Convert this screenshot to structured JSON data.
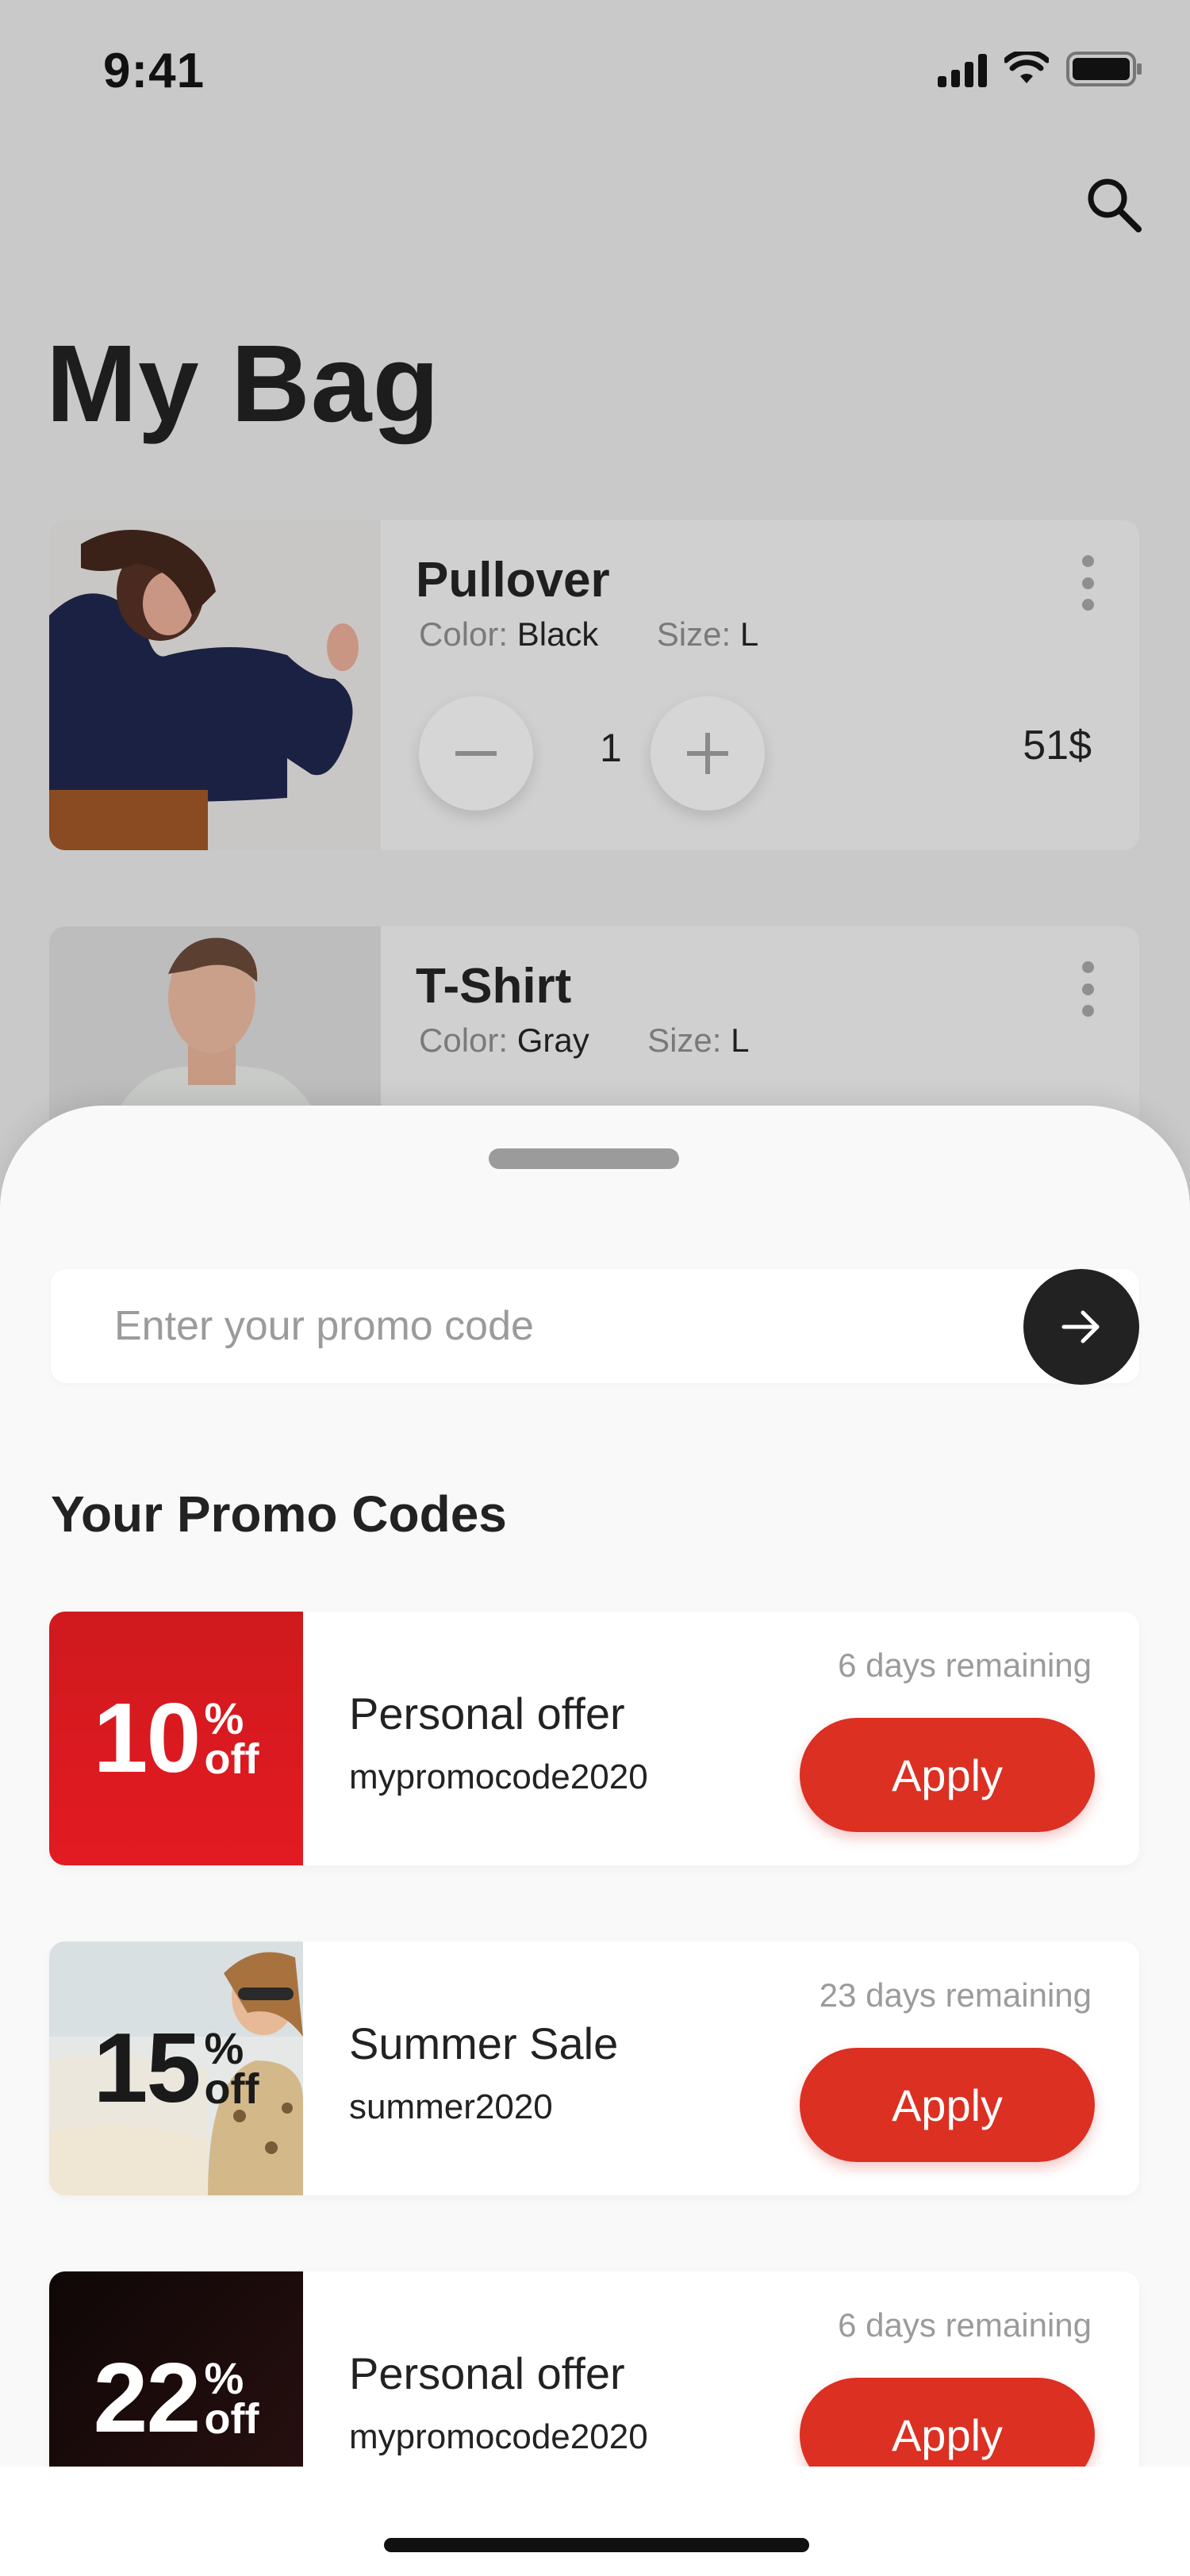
{
  "status_bar": {
    "time": "9:41",
    "icons": [
      "cellular-signal-icon",
      "wifi-icon",
      "battery-icon"
    ]
  },
  "header": {
    "title": "My Bag",
    "search_icon": "search-icon"
  },
  "bag_items": [
    {
      "name": "Pullover",
      "color_label": "Color:",
      "color": "Black",
      "size_label": "Size:",
      "size": "L",
      "quantity": "1",
      "price": "51$",
      "image": "woman-in-navy-pullover"
    },
    {
      "name": "T-Shirt",
      "color_label": "Color:",
      "color": "Gray",
      "size_label": "Size:",
      "size": "L",
      "image": "man-in-gray-tshirt"
    }
  ],
  "promo": {
    "placeholder": "Enter your promo code",
    "submit_icon": "arrow-right-icon",
    "section_title": "Your Promo Codes",
    "codes": [
      {
        "value": "10",
        "percent": "%",
        "off": "off",
        "title": "Personal offer",
        "code": "mypromocode2020",
        "remaining": "6 days remaining",
        "apply": "Apply",
        "badge_color": "#db1a1f"
      },
      {
        "value": "15",
        "percent": "%",
        "off": "off",
        "title": "Summer Sale",
        "code": "summer2020",
        "remaining": "23 days remaining",
        "apply": "Apply",
        "badge_color": "#e8e4dc"
      },
      {
        "value": "22",
        "percent": "%",
        "off": "off",
        "title": "Personal offer",
        "code": "mypromocode2020",
        "remaining": "6 days remaining",
        "apply": "Apply",
        "badge_color": "#1a0a0a"
      }
    ]
  },
  "colors": {
    "accent": "#db3022",
    "dark": "#222222",
    "sheet": "#f9f9f9",
    "overlay": "#c9c9c9"
  }
}
